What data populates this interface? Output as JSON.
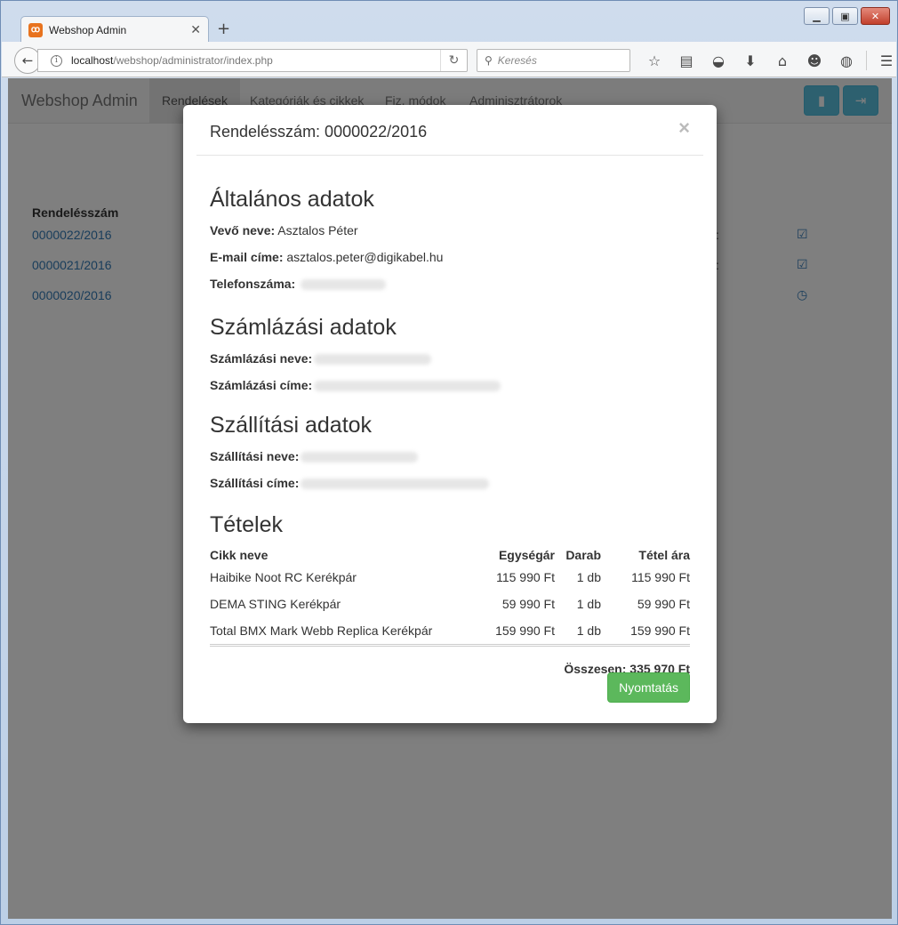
{
  "browser": {
    "tab_title": "Webshop Admin",
    "tab_favicon": "xampp-icon",
    "new_tab": "+",
    "url_host": "localhost",
    "url_path": "/webshop/administrator/index.php",
    "search_placeholder": "Keresés",
    "toolbar_icons": [
      "bookmark-star-icon",
      "reading-list-icon",
      "pocket-icon",
      "download-icon",
      "home-icon",
      "smiley-icon",
      "globe-icon",
      "menu-icon"
    ]
  },
  "app": {
    "brand": "Webshop Admin",
    "nav": [
      {
        "label": "Rendelések",
        "active": true
      },
      {
        "label": "Kategóriák és cikkek",
        "active": false
      },
      {
        "label": "Fiz. módok",
        "active": false
      },
      {
        "label": "Adminisztrátorok",
        "active": false
      }
    ],
    "orders": {
      "header": "Rendelésszám",
      "rows": [
        {
          "number": "0000022/2016",
          "status_icon": "check-square-icon"
        },
        {
          "number": "0000021/2016",
          "status_icon": "check-square-icon"
        },
        {
          "number": "0000020/2016",
          "status_icon": "clock-icon"
        }
      ]
    }
  },
  "modal": {
    "title": "Rendelésszám: 0000022/2016",
    "close": "×",
    "general": {
      "heading": "Általános adatok",
      "customer_label": "Vevő neve:",
      "customer_value": "Asztalos Péter",
      "email_label": "E-mail címe:",
      "email_value": "asztalos.peter@digikabel.hu",
      "phone_label": "Telefonszáma:"
    },
    "billing": {
      "heading": "Számlázási adatok",
      "name_label": "Számlázási neve:",
      "address_label": "Számlázási címe:"
    },
    "shipping": {
      "heading": "Szállítási adatok",
      "name_label": "Szállítási neve:",
      "address_label": "Szállítási címe:"
    },
    "items": {
      "heading": "Tételek",
      "columns": [
        "Cikk neve",
        "Egységár",
        "Darab",
        "Tétel ára"
      ],
      "rows": [
        [
          "Haibike Noot RC Kerékpár",
          "115 990 Ft",
          "1 db",
          "115 990 Ft"
        ],
        [
          "DEMA STING Kerékpár",
          "59 990 Ft",
          "1 db",
          "59 990 Ft"
        ],
        [
          "Total BMX Mark Webb Replica Kerékpár",
          "159 990 Ft",
          "1 db",
          "159 990 Ft"
        ]
      ],
      "total": "Összesen: 335 970 Ft"
    },
    "print_button": "Nyomtatás"
  }
}
